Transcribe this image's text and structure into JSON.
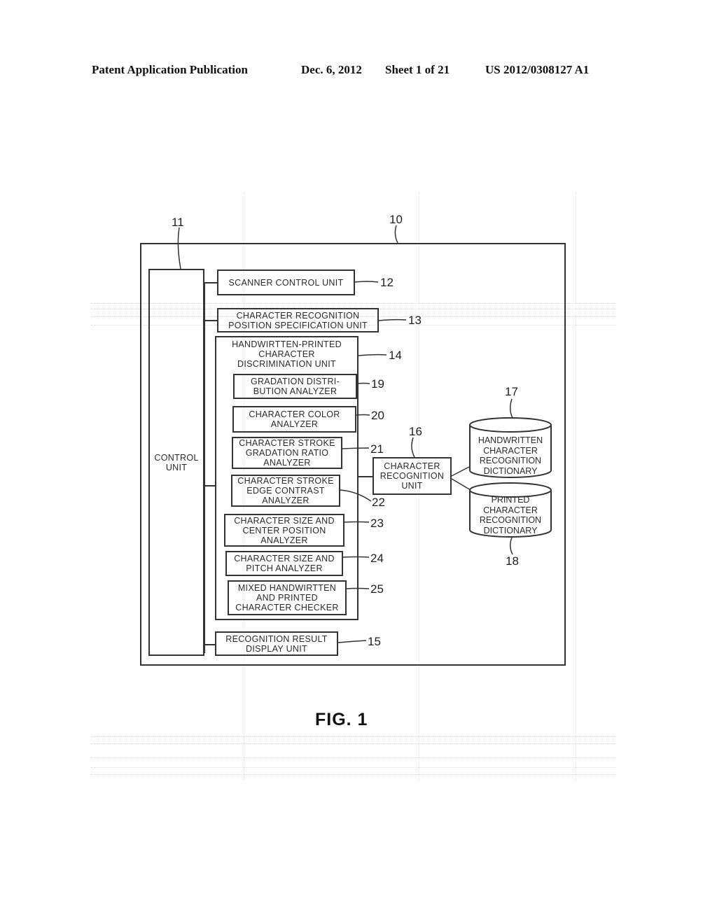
{
  "header": {
    "publication": "Patent Application Publication",
    "date": "Dec. 6, 2012",
    "sheet": "Sheet 1 of 21",
    "number": "US 2012/0308127 A1"
  },
  "diagram": {
    "device_ref": "10",
    "control_unit": {
      "label": "CONTROL\nUNIT",
      "ref": "11"
    },
    "scanner_control_unit": {
      "label": "SCANNER CONTROL UNIT",
      "ref": "12"
    },
    "position_spec_unit": {
      "label": "CHARACTER RECOGNITION\nPOSITION SPECIFICATION UNIT",
      "ref": "13"
    },
    "discrimination_unit": {
      "label": "HANDWIRTTEN-PRINTED\nCHARACTER\nDISCRIMINATION UNIT",
      "ref": "14",
      "analyzers": [
        {
          "label": "GRADATION DISTRI-\nBUTION ANALYZER",
          "ref": "19"
        },
        {
          "label": "CHARACTER COLOR\nANALYZER",
          "ref": "20"
        },
        {
          "label": "CHARACTER STROKE\nGRADATION RATIO\nANALYZER",
          "ref": "21"
        },
        {
          "label": "CHARACTER STROKE\nEDGE CONTRAST\nANALYZER",
          "ref": "22"
        },
        {
          "label": "CHARACTER SIZE AND\nCENTER POSITION\nANALYZER",
          "ref": "23"
        },
        {
          "label": "CHARACTER SIZE AND\nPITCH ANALYZER",
          "ref": "24"
        },
        {
          "label": "MIXED HANDWIRTTEN\nAND PRINTED\nCHARACTER CHECKER",
          "ref": "25"
        }
      ]
    },
    "result_display_unit": {
      "label": "RECOGNITION RESULT\nDISPLAY UNIT",
      "ref": "15"
    },
    "recognition_unit": {
      "label": "CHARACTER\nRECOGNITION\nUNIT",
      "ref": "16"
    },
    "handwritten_dictionary": {
      "label": "HANDWRITTEN\nCHARACTER\nRECOGNITION\nDICTIONARY",
      "ref": "17"
    },
    "printed_dictionary": {
      "label": "PRINTED\nCHARACTER\nRECOGNITION\nDICTIONARY",
      "ref": "18"
    }
  },
  "caption": "FIG. 1"
}
